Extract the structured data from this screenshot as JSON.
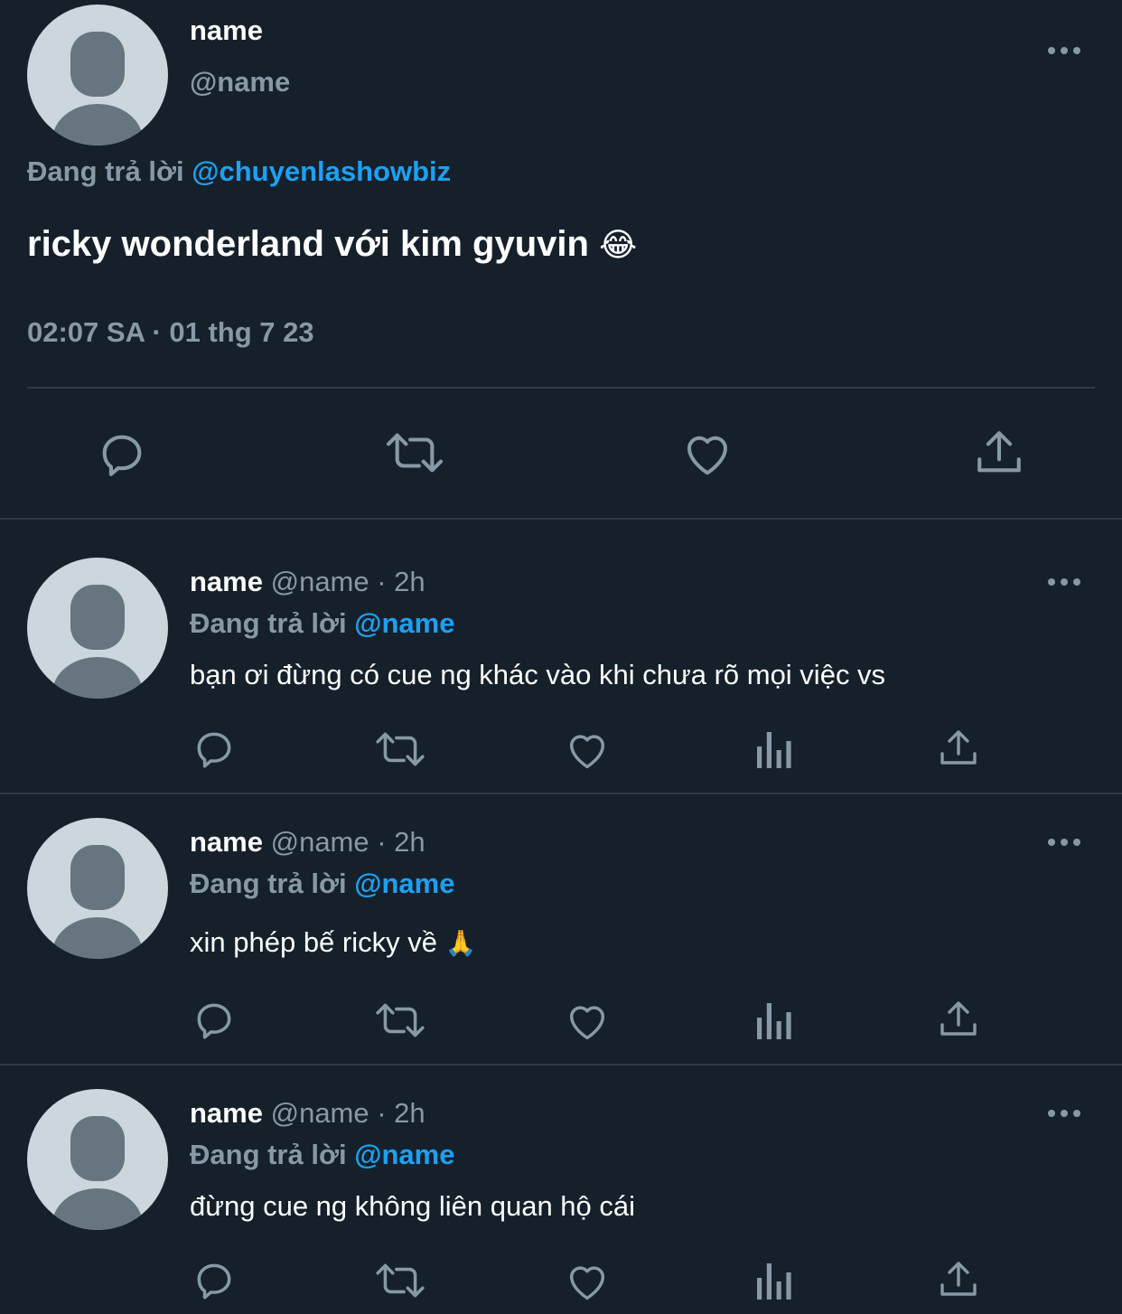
{
  "main_tweet": {
    "display_name": "name",
    "handle": "@name",
    "reply_prefix": "Đang trả lời",
    "reply_to": "@chuyenlashowbiz",
    "text": "ricky wonderland với kim gyuvin",
    "emoji": "😂",
    "timestamp": "02:07 SA · 01 thg 7 23",
    "actions": [
      "reply-icon",
      "retweet-icon",
      "like-icon",
      "share-icon"
    ]
  },
  "replies": [
    {
      "display_name": "name",
      "handle": "@name",
      "time": "· 2h",
      "reply_prefix": "Đang trả lời",
      "reply_to": "@name",
      "text": "bạn ơi đừng có cue ng khác vào khi chưa rõ mọi việc vs",
      "emoji": ""
    },
    {
      "display_name": "name",
      "handle": "@name",
      "time": "· 2h",
      "reply_prefix": "Đang trả lời",
      "reply_to": "@name",
      "text": "xin phép bế ricky về",
      "emoji": "🙏"
    },
    {
      "display_name": "name",
      "handle": "@name",
      "time": "· 2h",
      "reply_prefix": "Đang trả lời",
      "reply_to": "@name",
      "text": "đừng cue ng không liên quan hộ cái",
      "emoji": ""
    }
  ],
  "reply_actions": [
    "reply-icon",
    "retweet-icon",
    "like-icon",
    "analytics-icon",
    "share-icon"
  ],
  "colors": {
    "background": "#15202b",
    "text": "#ffffff",
    "muted": "#8899a6",
    "link": "#1da1f2",
    "avatar_bg": "#ccd6dd",
    "avatar_fg": "#66757f"
  }
}
